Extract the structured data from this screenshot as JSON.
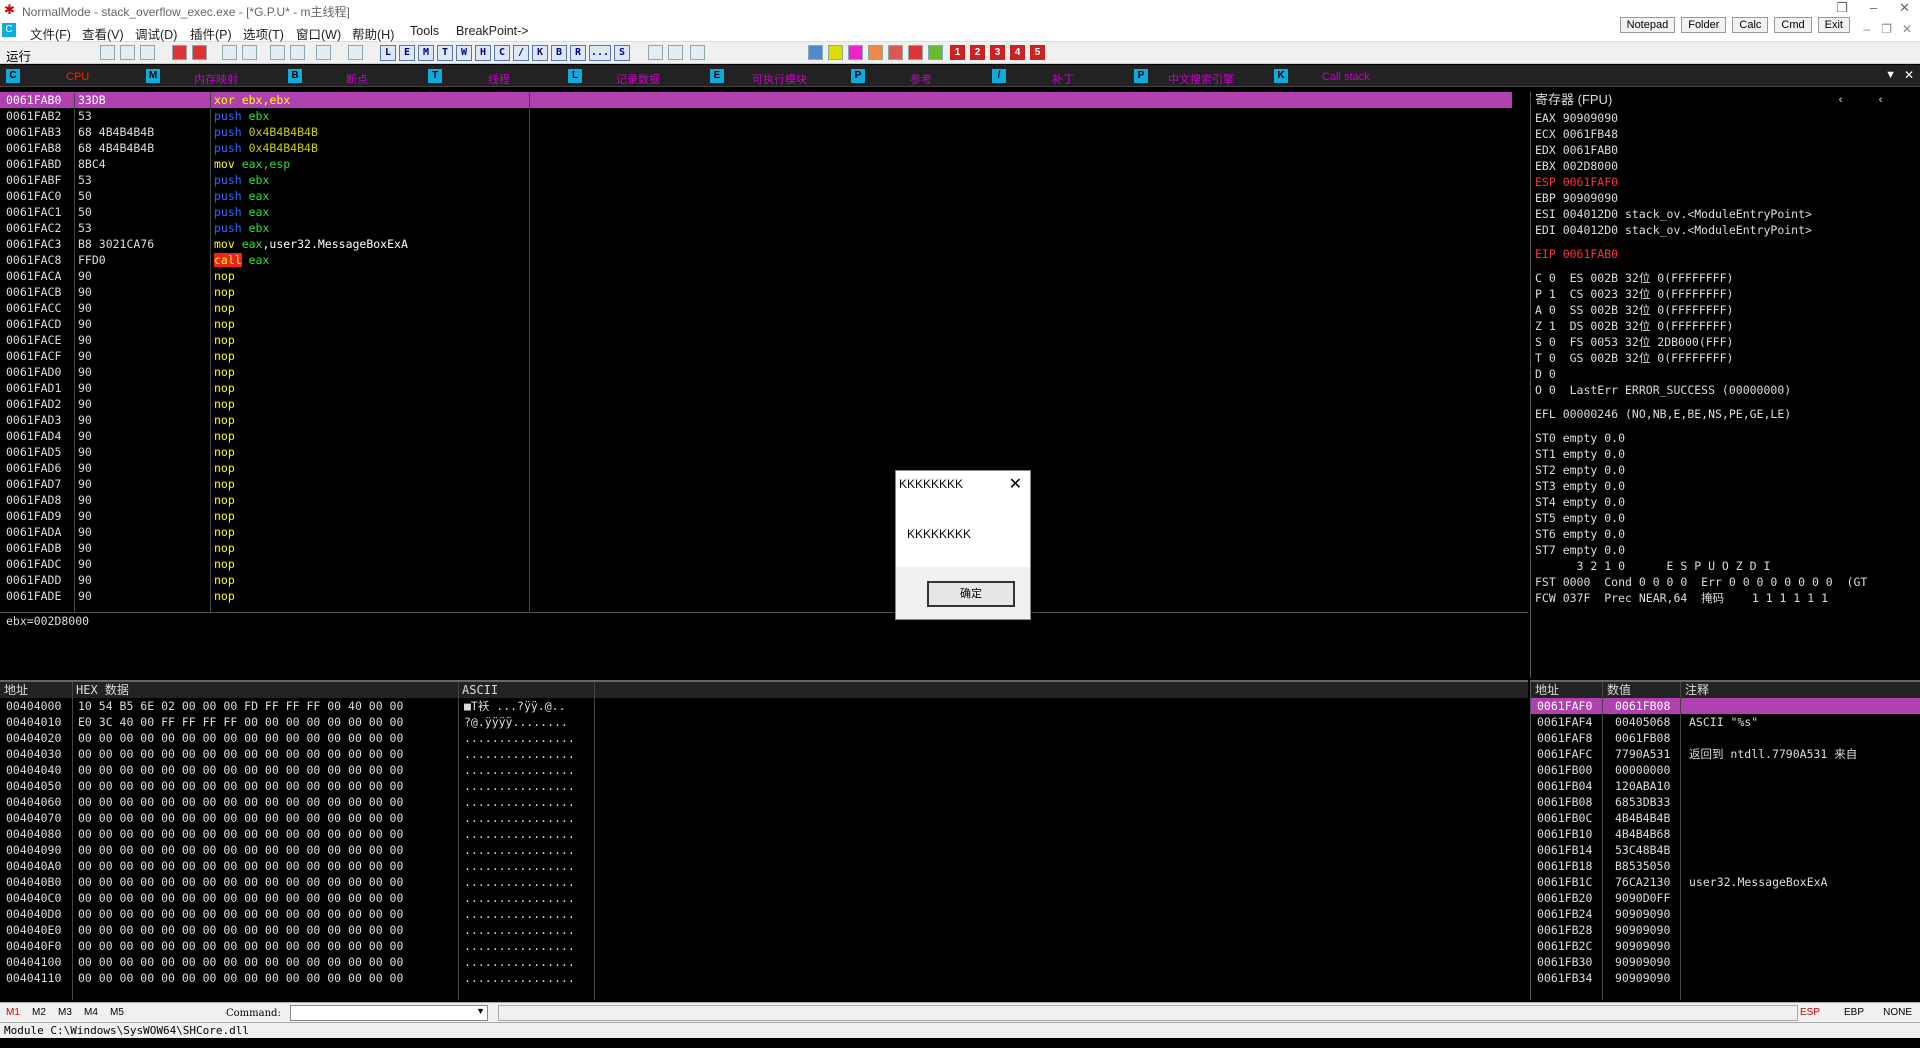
{
  "title": "NormalMode - stack_overflow_exec.exe - [*G.P.U* - m主线程]",
  "menu": [
    "文件(F)",
    "查看(V)",
    "调试(D)",
    "插件(P)",
    "选项(T)",
    "窗口(W)",
    "帮助(H)",
    "Tools",
    "BreakPoint->"
  ],
  "toolbtns": [
    "Notepad",
    "Folder",
    "Calc",
    "Cmd",
    "Exit"
  ],
  "run_label": "运行",
  "letters": [
    "L",
    "E",
    "M",
    "T",
    "W",
    "H",
    "C",
    "/",
    "K",
    "B",
    "R",
    "...",
    "S"
  ],
  "nums": [
    "1",
    "2",
    "3",
    "4",
    "5"
  ],
  "tabs": [
    {
      "key": "C",
      "label": "CPU"
    },
    {
      "key": "M",
      "label": "内存映射"
    },
    {
      "key": "B",
      "label": "断点"
    },
    {
      "key": "T",
      "label": "线程"
    },
    {
      "key": "L",
      "label": "记录数据"
    },
    {
      "key": "E",
      "label": "可执行模块"
    },
    {
      "key": "P",
      "label": "参考"
    },
    {
      "key": "/",
      "label": "补丁"
    },
    {
      "key": "P",
      "label": "中文搜索引擎"
    },
    {
      "key": "K",
      "label": "Call stack"
    }
  ],
  "disasm": [
    [
      "0061FAB0",
      "33DB",
      "xor ebx,ebx"
    ],
    [
      "0061FAB2",
      "53",
      "push ebx"
    ],
    [
      "0061FAB3",
      "68 4B4B4B4B",
      "push 0x4B4B4B4B"
    ],
    [
      "0061FAB8",
      "68 4B4B4B4B",
      "push 0x4B4B4B4B"
    ],
    [
      "0061FABD",
      "8BC4",
      "mov eax,esp"
    ],
    [
      "0061FABF",
      "53",
      "push ebx"
    ],
    [
      "0061FAC0",
      "50",
      "push eax"
    ],
    [
      "0061FAC1",
      "50",
      "push eax"
    ],
    [
      "0061FAC2",
      "53",
      "push ebx"
    ],
    [
      "0061FAC3",
      "B8 3021CA76",
      "mov eax,user32.MessageBoxExA"
    ],
    [
      "0061FAC8",
      "FFD0",
      "call eax"
    ],
    [
      "0061FACA",
      "90",
      "nop"
    ],
    [
      "0061FACB",
      "90",
      "nop"
    ],
    [
      "0061FACC",
      "90",
      "nop"
    ],
    [
      "0061FACD",
      "90",
      "nop"
    ],
    [
      "0061FACE",
      "90",
      "nop"
    ],
    [
      "0061FACF",
      "90",
      "nop"
    ],
    [
      "0061FAD0",
      "90",
      "nop"
    ],
    [
      "0061FAD1",
      "90",
      "nop"
    ],
    [
      "0061FAD2",
      "90",
      "nop"
    ],
    [
      "0061FAD3",
      "90",
      "nop"
    ],
    [
      "0061FAD4",
      "90",
      "nop"
    ],
    [
      "0061FAD5",
      "90",
      "nop"
    ],
    [
      "0061FAD6",
      "90",
      "nop"
    ],
    [
      "0061FAD7",
      "90",
      "nop"
    ],
    [
      "0061FAD8",
      "90",
      "nop"
    ],
    [
      "0061FAD9",
      "90",
      "nop"
    ],
    [
      "0061FADA",
      "90",
      "nop"
    ],
    [
      "0061FADB",
      "90",
      "nop"
    ],
    [
      "0061FADC",
      "90",
      "nop"
    ],
    [
      "0061FADD",
      "90",
      "nop"
    ],
    [
      "0061FADE",
      "90",
      "nop"
    ]
  ],
  "info_line": "ebx=002D8000",
  "reg_header": "寄存器 (FPU)",
  "regs1": [
    "EAX 90909090",
    "ECX 0061FB48",
    "EDX 0061FAB0",
    "EBX 002D8000",
    "ESP 0061FAF0",
    "EBP 90909090",
    "ESI 004012D0 stack_ov.<ModuleEntryPoint>",
    "EDI 004012D0 stack_ov.<ModuleEntryPoint>"
  ],
  "eip": "EIP 0061FAB0",
  "flags": [
    "C 0  ES 002B 32位 0(FFFFFFFF)",
    "P 1  CS 0023 32位 0(FFFFFFFF)",
    "A 0  SS 002B 32位 0(FFFFFFFF)",
    "Z 1  DS 002B 32位 0(FFFFFFFF)",
    "S 0  FS 0053 32位 2DB000(FFF)",
    "T 0  GS 002B 32位 0(FFFFFFFF)",
    "D 0",
    "O 0  LastErr ERROR_SUCCESS (00000000)"
  ],
  "efl": "EFL 00000246 (NO,NB,E,BE,NS,PE,GE,LE)",
  "fpu": [
    "ST0 empty 0.0",
    "ST1 empty 0.0",
    "ST2 empty 0.0",
    "ST3 empty 0.0",
    "ST4 empty 0.0",
    "ST5 empty 0.0",
    "ST6 empty 0.0",
    "ST7 empty 0.0"
  ],
  "fpu_bits": "      3 2 1 0      E S P U O Z D I",
  "fst": "FST 0000  Cond 0 0 0 0  Err 0 0 0 0 0 0 0 0  (GT",
  "fcw": "FCW 037F  Prec NEAR,64  掩码    1 1 1 1 1 1",
  "dump_headers": [
    "地址",
    "HEX 数据",
    "ASCII"
  ],
  "dump": [
    [
      "00404000",
      "10 54 B5 6E 02 00 00 00 FD FF FF FF 00 40 00 00",
      "■T袄 ...?ÿÿ.@.."
    ],
    [
      "00404010",
      "E0 3C 40 00 FF FF FF FF 00 00 00 00 00 00 00 00",
      "?@.ÿÿÿÿ........"
    ],
    [
      "00404020",
      "00 00 00 00 00 00 00 00 00 00 00 00 00 00 00 00",
      "................"
    ],
    [
      "00404030",
      "00 00 00 00 00 00 00 00 00 00 00 00 00 00 00 00",
      "................"
    ],
    [
      "00404040",
      "00 00 00 00 00 00 00 00 00 00 00 00 00 00 00 00",
      "................"
    ],
    [
      "00404050",
      "00 00 00 00 00 00 00 00 00 00 00 00 00 00 00 00",
      "................"
    ],
    [
      "00404060",
      "00 00 00 00 00 00 00 00 00 00 00 00 00 00 00 00",
      "................"
    ],
    [
      "00404070",
      "00 00 00 00 00 00 00 00 00 00 00 00 00 00 00 00",
      "................"
    ],
    [
      "00404080",
      "00 00 00 00 00 00 00 00 00 00 00 00 00 00 00 00",
      "................"
    ],
    [
      "00404090",
      "00 00 00 00 00 00 00 00 00 00 00 00 00 00 00 00",
      "................"
    ],
    [
      "004040A0",
      "00 00 00 00 00 00 00 00 00 00 00 00 00 00 00 00",
      "................"
    ],
    [
      "004040B0",
      "00 00 00 00 00 00 00 00 00 00 00 00 00 00 00 00",
      "................"
    ],
    [
      "004040C0",
      "00 00 00 00 00 00 00 00 00 00 00 00 00 00 00 00",
      "................"
    ],
    [
      "004040D0",
      "00 00 00 00 00 00 00 00 00 00 00 00 00 00 00 00",
      "................"
    ],
    [
      "004040E0",
      "00 00 00 00 00 00 00 00 00 00 00 00 00 00 00 00",
      "................"
    ],
    [
      "004040F0",
      "00 00 00 00 00 00 00 00 00 00 00 00 00 00 00 00",
      "................"
    ],
    [
      "00404100",
      "00 00 00 00 00 00 00 00 00 00 00 00 00 00 00 00",
      "................"
    ],
    [
      "00404110",
      "00 00 00 00 00 00 00 00 00 00 00 00 00 00 00 00",
      "................"
    ]
  ],
  "stack_headers": [
    "地址",
    "数值",
    "注释"
  ],
  "stack": [
    [
      "0061FAF0",
      "0061FB08",
      ""
    ],
    [
      "0061FAF4",
      "00405068",
      "ASCII \"%s\""
    ],
    [
      "0061FAF8",
      "0061FB08",
      ""
    ],
    [
      "0061FAFC",
      "7790A531",
      "返回到 ntdll.7790A531 来自"
    ],
    [
      "0061FB00",
      "00000000",
      ""
    ],
    [
      "0061FB04",
      "120ABA10",
      ""
    ],
    [
      "0061FB08",
      "6853DB33",
      ""
    ],
    [
      "0061FB0C",
      "4B4B4B4B",
      ""
    ],
    [
      "0061FB10",
      "4B4B4B68",
      ""
    ],
    [
      "0061FB14",
      "53C48B4B",
      ""
    ],
    [
      "0061FB18",
      "B8535050",
      ""
    ],
    [
      "0061FB1C",
      "76CA2130",
      "user32.MessageBoxExA"
    ],
    [
      "0061FB20",
      "9090D0FF",
      ""
    ],
    [
      "0061FB24",
      "90909090",
      ""
    ],
    [
      "0061FB28",
      "90909090",
      ""
    ],
    [
      "0061FB2C",
      "90909090",
      ""
    ],
    [
      "0061FB30",
      "90909090",
      ""
    ],
    [
      "0061FB34",
      "90909090",
      ""
    ]
  ],
  "dialog": {
    "title": "KKKKKKKK",
    "message": "KKKKKKKK",
    "ok": "确定"
  },
  "cmd": {
    "m_tabs": [
      "M1",
      "M2",
      "M3",
      "M4",
      "M5"
    ],
    "label": "Command:",
    "right": [
      "ESP",
      "EBP",
      "NONE"
    ]
  },
  "status": "Module C:\\Windows\\SysWOW64\\SHCore.dll",
  "colors": {
    "highlight": "#b03fb0",
    "mnemonic_nop": "#ff0",
    "push": "#00f",
    "call": "#f00"
  }
}
